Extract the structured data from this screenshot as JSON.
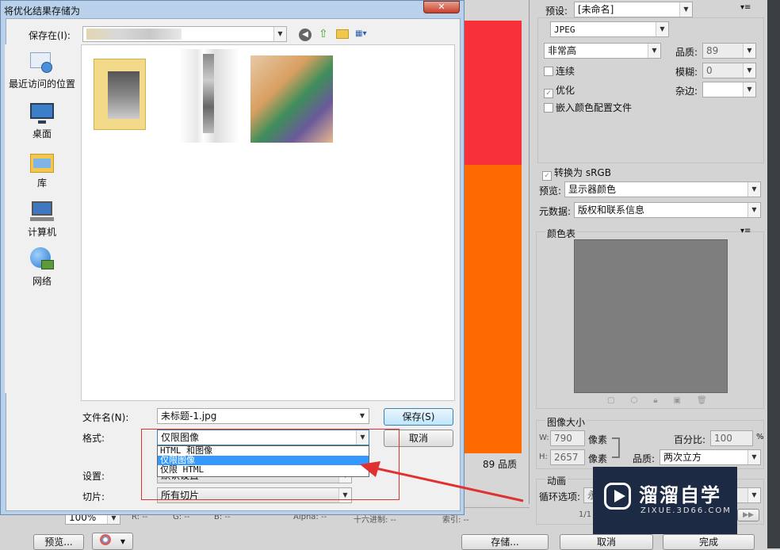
{
  "dialog": {
    "title": "将优化结果存储为",
    "save_in_label": "保存在(I):",
    "places": [
      {
        "label": "最近访问的位置",
        "icon": "recent-places-icon"
      },
      {
        "label": "桌面",
        "icon": "desktop-icon"
      },
      {
        "label": "库",
        "icon": "library-icon"
      },
      {
        "label": "计算机",
        "icon": "computer-icon"
      },
      {
        "label": "网络",
        "icon": "network-icon"
      }
    ],
    "filename_label": "文件名(N):",
    "filename_value": "未标题-1.jpg",
    "format_label": "格式:",
    "format_value": "仅限图像",
    "format_options": [
      "HTML 和图像",
      "仅限图像",
      "仅限 HTML"
    ],
    "settings_label": "设置:",
    "settings_value": "默认设置",
    "slices_label": "切片:",
    "slices_value": "所有切片",
    "save_button": "保存(S)",
    "cancel_button": "取消"
  },
  "canvas": {
    "quality_text": "89 品质",
    "colors": {
      "top": "#f8303a",
      "bottom": "#ff6a00"
    }
  },
  "statusbar": {
    "zoom": "100%",
    "r": "R: --",
    "g": "G: --",
    "b": "B: --",
    "alpha": "Alpha: --",
    "hex": "十六进制: --",
    "index": "索引: --"
  },
  "right_panel": {
    "preset_label": "预设:",
    "preset_value": "[未命名]",
    "format_value": "JPEG",
    "quality_level": "非常高",
    "quality_label": "品质:",
    "quality_value": "89",
    "progressive_label": "连续",
    "blur_label": "模糊:",
    "blur_value": "0",
    "optimized_label": "优化",
    "matte_label": "杂边:",
    "embed_profile_label": "嵌入颜色配置文件",
    "convert_srgb_label": "转换为 sRGB",
    "preview_label": "预览:",
    "preview_value": "显示器颜色",
    "metadata_label": "元数据:",
    "metadata_value": "版权和联系信息",
    "color_table_label": "颜色表",
    "image_size_label": "图像大小",
    "w_label": "W:",
    "w_value": "790",
    "h_label": "H:",
    "h_value": "2657",
    "px_label": "像素",
    "percent_label": "百分比:",
    "percent_value": "100",
    "percent_unit": "%",
    "resample_label": "品质:",
    "resample_value": "两次立方",
    "animation_label": "动画",
    "loop_label": "循环选项:",
    "loop_value": "永远",
    "frame_counter": "1/1"
  },
  "bottom_buttons": {
    "preview": "预览...",
    "save": "存储...",
    "cancel": "取消",
    "done": "完成"
  },
  "watermark": {
    "brand": "溜溜自学",
    "url": "ZIXUE.3D66.COM"
  },
  "accent_colors": {
    "selection": "#3399ff",
    "annotation": "#e03030"
  }
}
